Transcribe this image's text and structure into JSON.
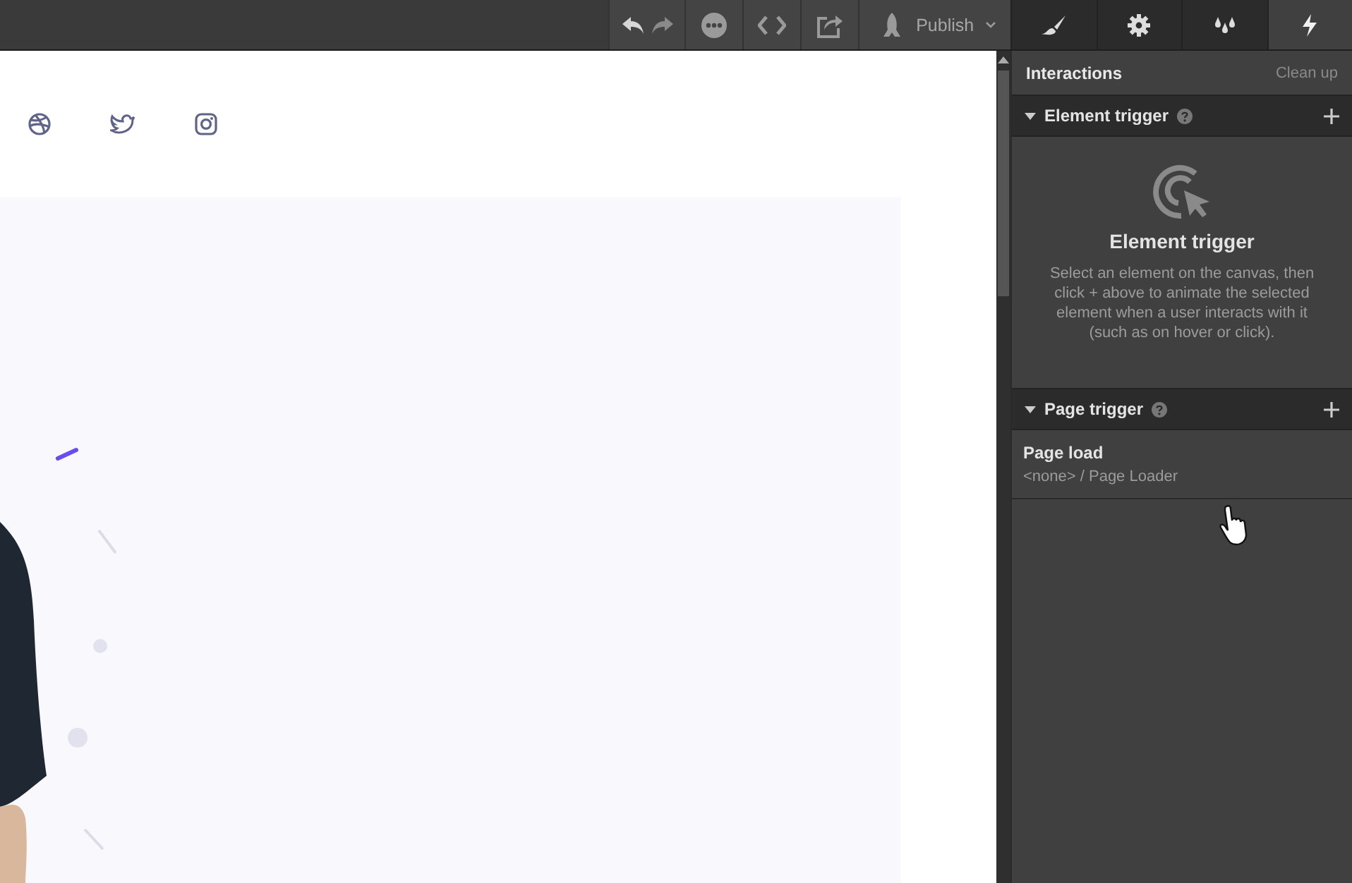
{
  "toolbar": {
    "publish_label": "Publish"
  },
  "panel_tabs": [
    {
      "selected": false
    },
    {
      "selected": false
    },
    {
      "selected": false
    },
    {
      "selected": true
    }
  ],
  "panel": {
    "title": "Interactions",
    "action": "Clean up",
    "element_trigger": {
      "title": "Element trigger",
      "empty_title": "Element trigger",
      "empty_text": "Select an element on the canvas, then click + above to animate the selected element when a user interacts with it (such as on hover or click)."
    },
    "page_trigger": {
      "title": "Page trigger",
      "items": [
        {
          "name": "Page load",
          "detail": "<none> / Page Loader"
        }
      ]
    }
  }
}
